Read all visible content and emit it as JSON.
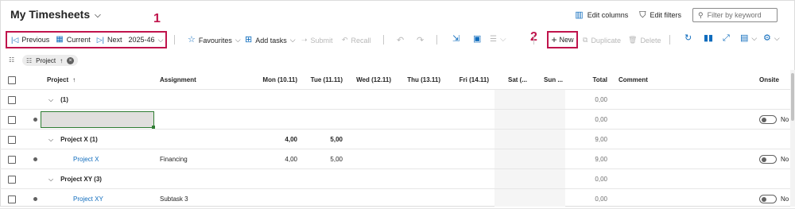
{
  "header": {
    "title": "My Timesheets",
    "edit_columns": "Edit columns",
    "edit_filters": "Edit filters",
    "filter_placeholder": "Filter by keyword"
  },
  "nav": {
    "previous": "Previous",
    "current": "Current",
    "next": "Next",
    "period": "2025-46"
  },
  "toolbar": {
    "favourites": "Favourites",
    "add_tasks": "Add tasks",
    "submit": "Submit",
    "recall": "Recall",
    "new": "New",
    "duplicate": "Duplicate",
    "delete": "Delete"
  },
  "annotations": {
    "one": "1",
    "two": "2"
  },
  "grouping": {
    "chip_label": "Project"
  },
  "columns": {
    "project": "Project",
    "assignment": "Assignment",
    "mon": "Mon (10.11)",
    "tue": "Tue (11.11)",
    "wed": "Wed (12.11)",
    "thu": "Thu (13.11)",
    "fri": "Fri (14.11)",
    "sat": "Sat (...",
    "sun": "Sun ...",
    "total": "Total",
    "comment": "Comment",
    "onsite": "Onsite"
  },
  "rows": [
    {
      "group_label": "(1)",
      "total": "0,00"
    },
    {
      "total": "0,00",
      "onsite": "No"
    },
    {
      "group_label": "Project X (1)",
      "mon": "4,00",
      "tue": "5,00",
      "total": "9,00"
    },
    {
      "project": "Project X",
      "assignment": "Financing",
      "mon": "4,00",
      "tue": "5,00",
      "total": "9,00",
      "onsite": "No"
    },
    {
      "group_label": "Project XY (3)",
      "total": "0,00"
    },
    {
      "project": "Project XY",
      "assignment": "Subtask 3",
      "total": "0,00",
      "onsite": "No"
    }
  ]
}
